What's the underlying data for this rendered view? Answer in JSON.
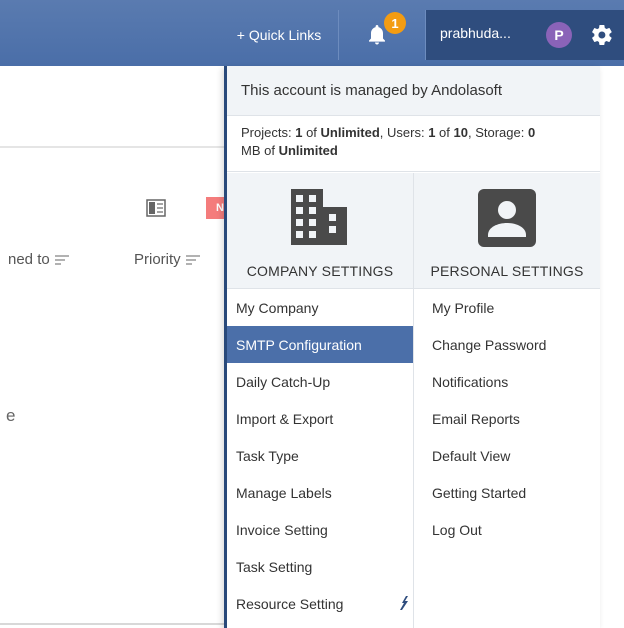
{
  "topbar": {
    "quick_links": "+ Quick Links",
    "notification_count": "1",
    "username": "prabhuda...",
    "avatar_initial": "P"
  },
  "background": {
    "new_badge": "N",
    "col_assigned": "ned to",
    "col_priority": "Priority",
    "stray_text": "e"
  },
  "dropdown": {
    "managed_text": "This account is managed by Andolasoft",
    "quota": {
      "projects_label": "Projects:",
      "projects_used": "1",
      "of1": "of",
      "projects_limit": "Unlimited",
      "users_label": "Users:",
      "users_used": "1",
      "of2": "of",
      "users_limit": "10",
      "storage_label": "Storage:",
      "storage_used": "0",
      "storage_unit": "MB of",
      "storage_limit": "Unlimited"
    },
    "company": {
      "title": "COMPANY SETTINGS",
      "items": [
        "My Company",
        "SMTP Configuration",
        "Daily Catch-Up",
        "Import & Export",
        "Task Type",
        "Manage Labels",
        "Invoice Setting",
        "Task Setting",
        "Resource Setting"
      ],
      "active_index": 1
    },
    "personal": {
      "title": "PERSONAL SETTINGS",
      "items": [
        "My Profile",
        "Change Password",
        "Notifications",
        "Email Reports",
        "Default View",
        "Getting Started",
        "Log Out"
      ]
    }
  },
  "colors": {
    "topbar": "#4a6ea8",
    "user_area": "#2f4d7e",
    "active_item": "#4b6fa9",
    "badge": "#f39c12"
  }
}
